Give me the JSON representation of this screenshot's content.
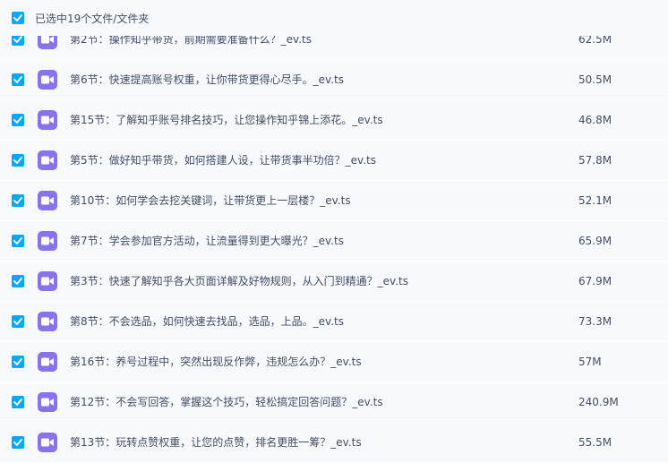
{
  "header": {
    "select_all_checked": true,
    "title": "已选中19个文件/文件夹"
  },
  "files": [
    {
      "name": "第2节：操作知乎带货，前期需要准备什么？_ev.ts",
      "size": "62.5M",
      "checked": true
    },
    {
      "name": "第6节：快速提高账号权重，让你带货更得心尽手。_ev.ts",
      "size": "50.5M",
      "checked": true
    },
    {
      "name": "第15节：了解知乎账号排名技巧，让您操作知乎锦上添花。_ev.ts",
      "size": "46.8M",
      "checked": true
    },
    {
      "name": "第5节：做好知乎带货，如何搭建人设，让带货事半功倍？_ev.ts",
      "size": "57.8M",
      "checked": true
    },
    {
      "name": "第10节：如何学会去挖关键词，让带货更上一层楼？_ev.ts",
      "size": "52.1M",
      "checked": true
    },
    {
      "name": "第7节：学会参加官方活动，让流量得到更大曝光？_ev.ts",
      "size": "65.9M",
      "checked": true
    },
    {
      "name": "第3节：快速了解知乎各大页面详解及好物规则，从入门到精通？_ev.ts",
      "size": "67.9M",
      "checked": true
    },
    {
      "name": "第8节：不会选品，如何快速去找品，选品，上品。_ev.ts",
      "size": "73.3M",
      "checked": true
    },
    {
      "name": "第16节：养号过程中，突然出现反作弊，违规怎么办？_ev.ts",
      "size": "57M",
      "checked": true
    },
    {
      "name": "第12节：不会写回答，掌握这个技巧，轻松搞定回答问题？_ev.ts",
      "size": "240.9M",
      "checked": true
    },
    {
      "name": "第13节：玩转点赞权重，让您的点赞，排名更胜一筹？_ev.ts",
      "size": "55.5M",
      "checked": true
    }
  ],
  "colors": {
    "checkbox": "#06a7ff",
    "video_icon": "#8a72ee",
    "row_bg": "#f7f9fc",
    "text": "#424e67"
  },
  "icons": {
    "checkbox": "checkmark-icon",
    "file": "video-file-icon"
  }
}
